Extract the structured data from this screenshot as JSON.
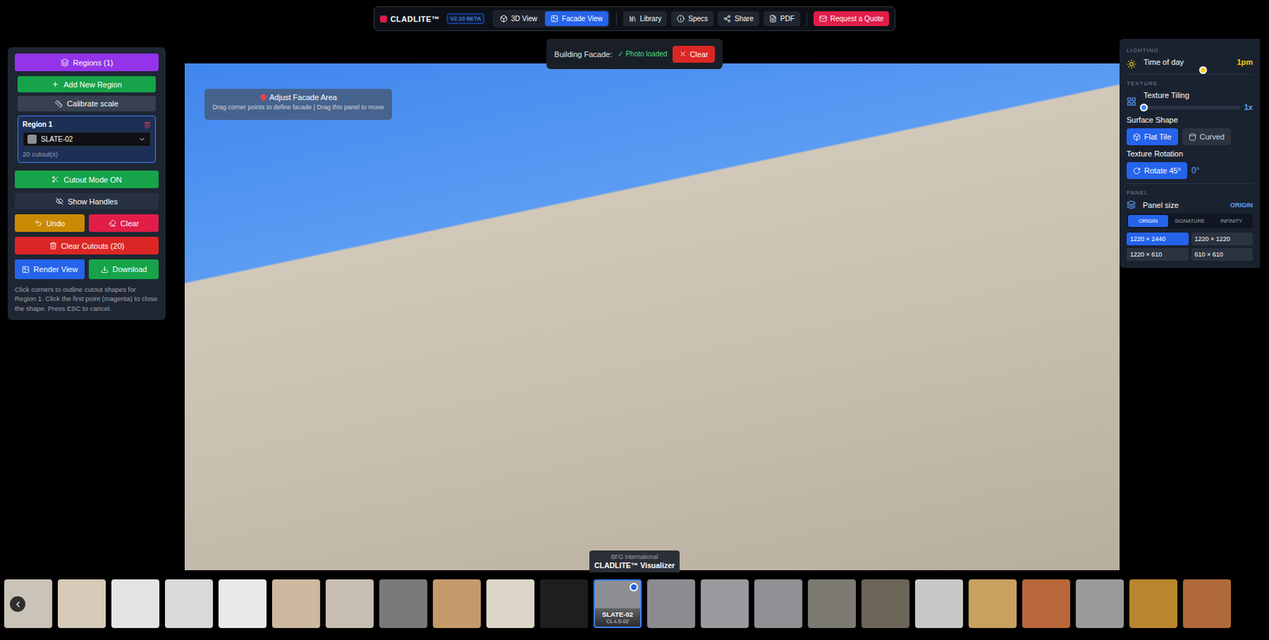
{
  "toolbar": {
    "logo": "CLADLITE™",
    "version": "V2.10 BETA",
    "views": [
      {
        "label": "3D View",
        "selected": false
      },
      {
        "label": "Facade View",
        "selected": true
      }
    ],
    "actions": [
      "Library",
      "Specs",
      "Share",
      "PDF"
    ],
    "quote": "Request a Quote"
  },
  "facade_status": {
    "label": "Building Facade:",
    "status": "✓ Photo loaded",
    "clear": "Clear"
  },
  "left_panel": {
    "regions_button": "Regions (1)",
    "add_region": "Add New Region",
    "calibrate": "Calibrate scale",
    "region": {
      "title": "Region 1",
      "material": "SLATE-02",
      "cutouts": "20 cutout(s)",
      "selected": true
    },
    "cutout_mode": "Cutout Mode ON",
    "show_handles": "Show Handles",
    "undo": "Undo",
    "clear": "Clear",
    "clear_cutouts": "Clear Cutouts (20)",
    "render": "Render View",
    "download": "Download",
    "help": "Click corners to outline cutout shapes for Region 1. Click the first point (magenta) to close the shape. Press ESC to cancel."
  },
  "canvas": {
    "hint_title": "Adjust Facade Area",
    "hint_sub": "Drag corner points to define facade | Drag this panel to move"
  },
  "right_panel": {
    "lighting_title": "LIGHTING",
    "time_label": "Time of day",
    "time_value": "1pm",
    "time_level": 0.54,
    "texture_title": "TEXTURE",
    "tiling_label": "Texture Tiling",
    "tiling_value": "1x",
    "tiling_level": 0.0,
    "surface_label": "Surface Shape",
    "shapes": [
      {
        "label": "Flat Tile",
        "selected": true
      },
      {
        "label": "Curved",
        "selected": false
      }
    ],
    "rotation_label": "Texture Rotation",
    "rotate_button": "Rotate 45°",
    "rotation_value": "0°",
    "panel_title": "PANEL",
    "panel_size_label": "Panel size",
    "panel_series": "ORIGIN",
    "series": [
      {
        "label": "ORIGIN",
        "selected": true
      },
      {
        "label": "SIGNATURE",
        "selected": false
      },
      {
        "label": "INFINITY",
        "selected": false
      }
    ],
    "sizes": [
      {
        "label": "1220 × 2440",
        "selected": true
      },
      {
        "label": "1220 × 1220",
        "selected": false
      },
      {
        "label": "1220 × 610",
        "selected": false
      },
      {
        "label": "610 × 610",
        "selected": false
      }
    ]
  },
  "tooltip": {
    "brand": "BFG International",
    "product": "CLADLITE™ Visualizer"
  },
  "materials": [
    {
      "color": "#c9c3b8",
      "selected": false
    },
    {
      "color": "#d6cbb8",
      "selected": false
    },
    {
      "color": "#e4e4e4",
      "selected": false
    },
    {
      "color": "#dadada",
      "selected": false
    },
    {
      "color": "#e9e9e9",
      "selected": false
    },
    {
      "color": "#cdb8a0",
      "selected": false
    },
    {
      "color": "#c8beb3",
      "selected": false
    },
    {
      "color": "#7a7a7a",
      "selected": false
    },
    {
      "color": "#c49a6a",
      "selected": false
    },
    {
      "color": "#ddd5c8",
      "selected": false
    },
    {
      "color": "#1e1e1e",
      "selected": false
    },
    {
      "color": "#8e8f93",
      "selected": true,
      "label": "SLATE-02",
      "code": "CL-LS-02"
    },
    {
      "color": "#8a8c90",
      "selected": false
    },
    {
      "color": "#9a9b9e",
      "selected": false
    },
    {
      "color": "#8f9094",
      "selected": false
    },
    {
      "color": "#7d7a72",
      "selected": false
    },
    {
      "color": "#6b6558",
      "selected": false
    },
    {
      "color": "#c8c8c8",
      "selected": false
    },
    {
      "color": "#c8a060",
      "selected": false
    },
    {
      "color": "#b8683a",
      "selected": false
    },
    {
      "color": "#9a9a9a",
      "selected": false
    },
    {
      "color": "#b8862e",
      "selected": false
    },
    {
      "color": "#b06a3a",
      "selected": false
    }
  ]
}
